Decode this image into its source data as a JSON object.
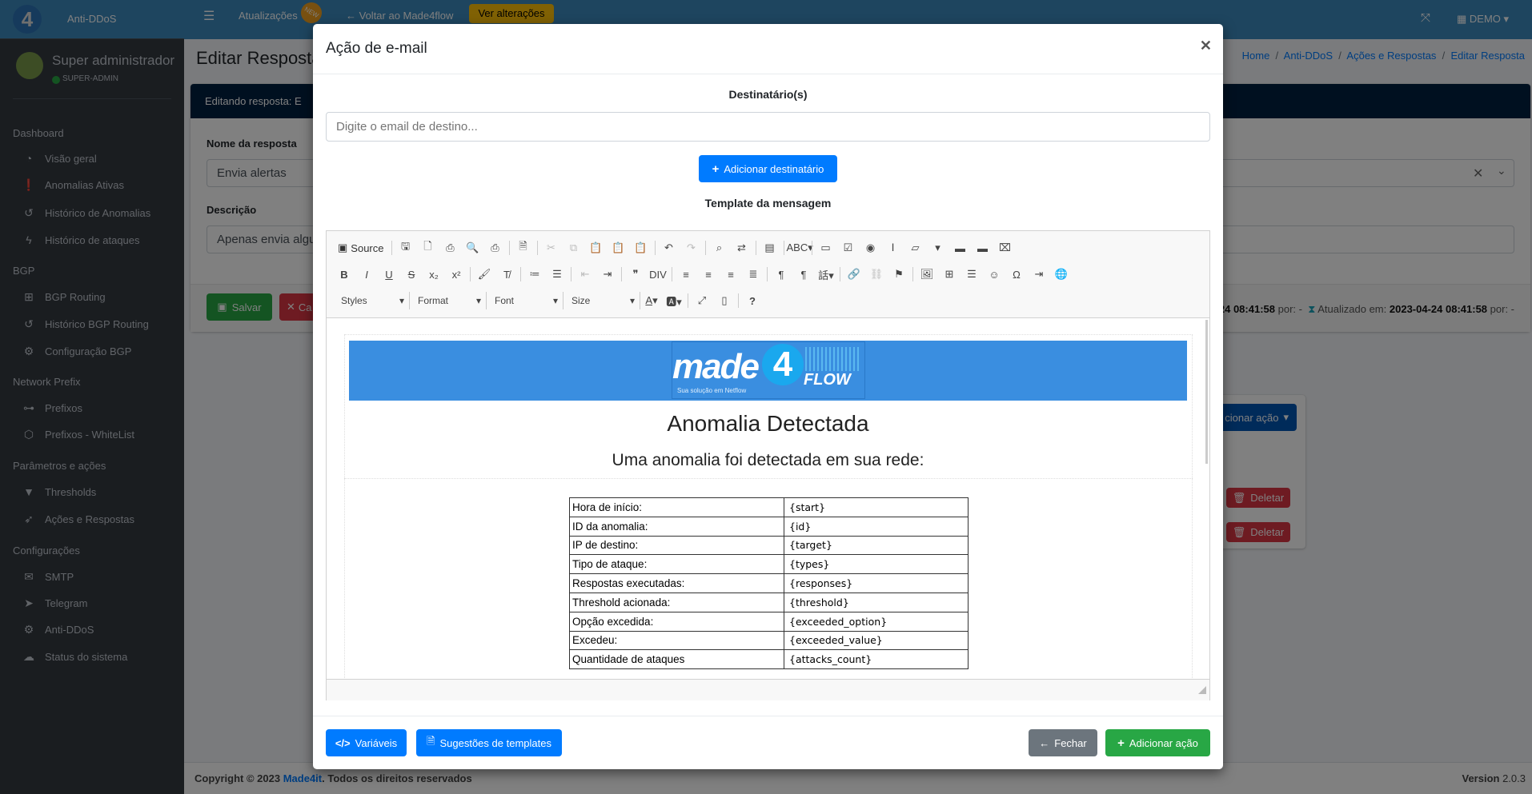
{
  "topbar": {
    "brand": "Anti-DDoS",
    "updates": "Atualizações",
    "new_badge": "NEW",
    "back": "Voltar ao Made4flow",
    "changes": "Ver alterações",
    "tenant": "DEMO"
  },
  "user": {
    "name": "Super administrador",
    "role": "SUPER-ADMIN"
  },
  "sidebar": [
    {
      "section": "Dashboard",
      "items": [
        {
          "label": "Visão geral",
          "icon": "tachometer-icon"
        },
        {
          "label": "Anomalias Ativas",
          "icon": "exclamation-circle-icon"
        },
        {
          "label": "Histórico de Anomalias",
          "icon": "history-icon"
        },
        {
          "label": "Histórico de ataques",
          "icon": "bolt-icon"
        }
      ]
    },
    {
      "section": "BGP",
      "items": [
        {
          "label": "BGP Routing",
          "icon": "sitemap-icon"
        },
        {
          "label": "Histórico BGP Routing",
          "icon": "history-icon"
        },
        {
          "label": "Configuração BGP",
          "icon": "gear-icon"
        }
      ]
    },
    {
      "section": "Network Prefix",
      "items": [
        {
          "label": "Prefixos",
          "icon": "network-icon"
        },
        {
          "label": "Prefixos - WhiteList",
          "icon": "hexagon-icon"
        }
      ]
    },
    {
      "section": "Parâmetros e ações",
      "items": [
        {
          "label": "Thresholds",
          "icon": "filter-icon"
        },
        {
          "label": "Ações e Respostas",
          "icon": "rocket-icon"
        }
      ]
    },
    {
      "section": "Configurações",
      "items": [
        {
          "label": "SMTP",
          "icon": "mail-server-icon"
        },
        {
          "label": "Telegram",
          "icon": "telegram-icon"
        },
        {
          "label": "Anti-DDoS",
          "icon": "gears-icon"
        },
        {
          "label": "Status do sistema",
          "icon": "cloud-upload-icon"
        }
      ]
    }
  ],
  "page": {
    "title": "Editar Resposta",
    "breadcrumb": [
      "Home",
      "Anti-DDoS",
      "Ações e Respostas",
      "Editar Resposta"
    ],
    "card_header": "Editando resposta: E",
    "name_label": "Nome da resposta",
    "name_value": "Envia alertas",
    "desc_label": "Descrição",
    "desc_value": "Apenas envia algu",
    "save": "Salvar",
    "cancel": "Ca",
    "created_tail": "-24 08:41:58",
    "by": "por: -",
    "updated_label": "Atualizado em:",
    "updated_value": "2023-04-24 08:41:58",
    "add_action": "cionar ação",
    "delete": "Deletar"
  },
  "footer": {
    "copyright": "Copyright © 2023 ",
    "company": "Made4it",
    "rights": ". Todos os direitos reservados",
    "version_label": "Version",
    "version": "2.0.3"
  },
  "modal": {
    "title": "Ação de e-mail",
    "recipients_label": "Destinatário(s)",
    "recipient_placeholder": "Digite o email de destino...",
    "add_recipient": "Adicionar destinatário",
    "template_label": "Template da mensagem",
    "editor": {
      "source": "Source",
      "combos": [
        "Styles",
        "Format",
        "Font",
        "Size"
      ],
      "logo_text": "made",
      "logo_num": "4",
      "logo_flow": "FLOW",
      "logo_tagline": "Sua solução em Netflow",
      "heading": "Anomalia Detectada",
      "subheading": "Uma anomalia foi detectada em sua rede:",
      "rows": [
        [
          "Hora de início:",
          "{start}"
        ],
        [
          "ID da anomalia:",
          "{id}"
        ],
        [
          "IP de destino:",
          "{target}"
        ],
        [
          "Tipo de ataque:",
          "{types}"
        ],
        [
          "Respostas executadas:",
          "{responses}"
        ],
        [
          "Threshold acionada:",
          "{threshold}"
        ],
        [
          "Opção excedida:",
          "{exceeded_option}"
        ],
        [
          "Excedeu:",
          "{exceeded_value}"
        ],
        [
          "Quantidade de ataques",
          "{attacks_count}"
        ]
      ]
    },
    "variables": "Variáveis",
    "suggestions": "Sugestões de templates",
    "close": "Fechar",
    "add_action": "Adicionar ação"
  },
  "colors": {
    "primary": "#007bff",
    "success": "#28a745",
    "secondary": "#6c757d",
    "danger": "#dc3545",
    "banner": "#3a8ee0"
  }
}
